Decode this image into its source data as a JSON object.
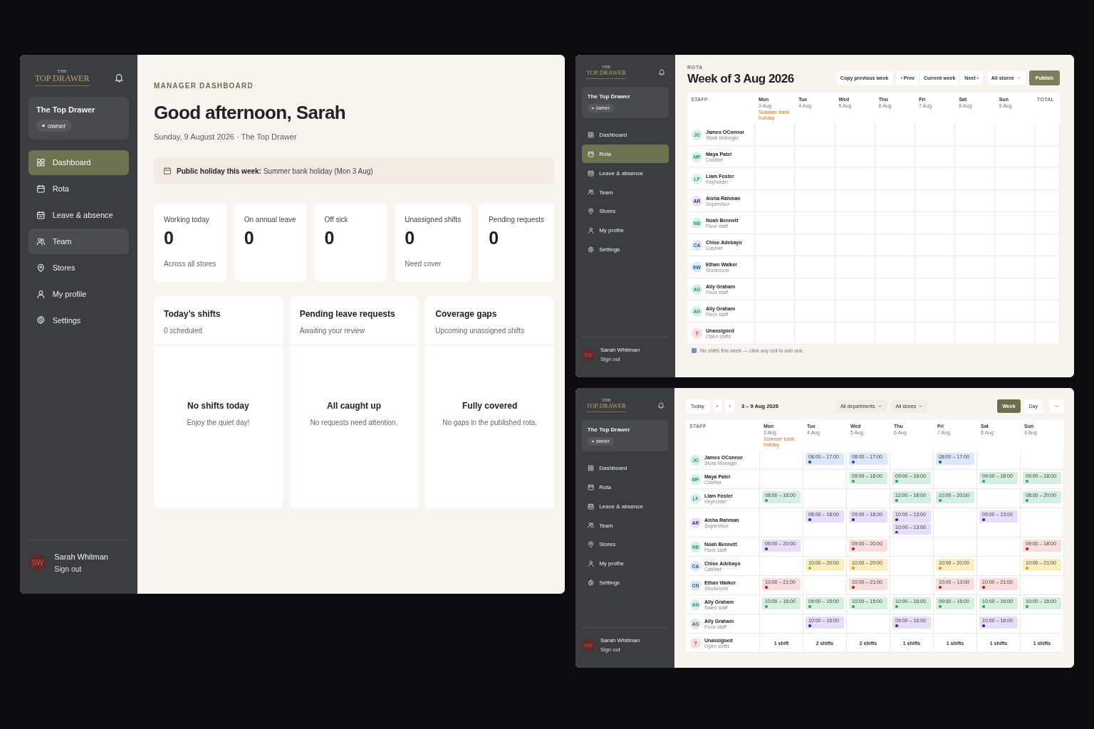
{
  "dashboard": {
    "sidebar": {
      "logo_small": "THE",
      "logo": "TOP DRAWER",
      "store": "The Top Drawer",
      "role": "owner",
      "nav": [
        {
          "label": "Dashboard",
          "selected": true,
          "hovered": false
        },
        {
          "label": "Rota",
          "selected": false,
          "hovered": false
        },
        {
          "label": "Leave & absence",
          "selected": false,
          "hovered": false
        },
        {
          "label": "Team",
          "selected": false,
          "hovered": true
        },
        {
          "label": "Stores",
          "selected": false,
          "hovered": false
        },
        {
          "label": "My profile",
          "selected": false,
          "hovered": false
        },
        {
          "label": "Settings",
          "selected": false,
          "hovered": false
        }
      ],
      "user": {
        "initials": "SW",
        "name": "Sarah Whitman",
        "sign_out": "Sign out"
      }
    },
    "eyebrow": "MANAGER DASHBOARD",
    "greeting": "Good afternoon, Sarah",
    "date_line": "Sunday, 9 August 2026 · The Top Drawer",
    "holiday_banner": "**Public holiday this week:** Summer bank holiday (Mon 3 Aug)",
    "stats": [
      {
        "label": "Working today",
        "value": "0",
        "note": "Across all stores"
      },
      {
        "label": "On annual leave",
        "value": "0"
      },
      {
        "label": "Off sick",
        "value": "0"
      },
      {
        "label": "Unassigned shifts",
        "value": "0",
        "note": "Need cover"
      },
      {
        "label": "Pending requests",
        "value": "0"
      }
    ],
    "panels": [
      {
        "title": "Today’s shifts",
        "subtitle": "0 scheduled",
        "empty_title": "No shifts today",
        "empty_text": "Enjoy the quiet day!"
      },
      {
        "title": "Pending leave requests",
        "subtitle": "Awaiting your review",
        "empty_title": "All caught up",
        "empty_text": "No requests need attention."
      },
      {
        "title": "Coverage gaps",
        "subtitle": "Upcoming unassigned shifts",
        "empty_title": "Fully covered",
        "empty_text": "No gaps in the published rota."
      }
    ]
  },
  "rota_empty": {
    "sidebar": {
      "logo_small": "THE",
      "logo": "TOP DRAWER",
      "store": "The Top Drawer",
      "role": "owner",
      "nav": [
        {
          "label": "Dashboard",
          "selected": false,
          "hovered": false
        },
        {
          "label": "Rota",
          "selected": true,
          "hovered": false
        },
        {
          "label": "Leave & absence",
          "selected": false,
          "hovered": false
        },
        {
          "label": "Team",
          "selected": false,
          "hovered": false
        },
        {
          "label": "Stores",
          "selected": false,
          "hovered": false
        },
        {
          "label": "My profile",
          "selected": false,
          "hovered": false
        },
        {
          "label": "Settings",
          "selected": false,
          "hovered": false
        }
      ],
      "user": {
        "initials": "SW",
        "name": "Sarah Whitman",
        "sign_out": "Sign out"
      }
    },
    "eyebrow": "ROTA",
    "title": "Week of 3 Aug 2026",
    "toolbar": {
      "copy": "Copy previous week",
      "nav_buttons": [
        "‹ Prev",
        "Current week",
        "Next ›"
      ],
      "store_filter": "All stores",
      "publish": "Publish"
    },
    "grid": {
      "staff_label": "STAFF",
      "total_label": "TOTAL",
      "days": [
        {
          "day": "Mon",
          "date": "3 Aug",
          "note": "Summer bank holiday"
        },
        {
          "day": "Tue",
          "date": "4 Aug"
        },
        {
          "day": "Wed",
          "date": "5 Aug"
        },
        {
          "day": "Thu",
          "date": "6 Aug"
        },
        {
          "day": "Fri",
          "date": "7 Aug"
        },
        {
          "day": "Sat",
          "date": "8 Aug"
        },
        {
          "day": "Sun",
          "date": "9 Aug"
        }
      ],
      "rows": [
        {
          "initials": "JO",
          "name": "James OConnor",
          "role": "Store Manager",
          "color": "#d6f0eb"
        },
        {
          "initials": "MP",
          "name": "Maya Patel",
          "role": "Cashier",
          "color": "#d6f0eb"
        },
        {
          "initials": "LF",
          "name": "Liam Foster",
          "role": "Keyholder",
          "color": "#d6f0eb"
        },
        {
          "initials": "AR",
          "name": "Aisha Rahman",
          "role": "Supervisor",
          "color": "#e9e1f8"
        },
        {
          "initials": "NB",
          "name": "Noah Bennett",
          "role": "Floor staff",
          "color": "#d6f0eb"
        },
        {
          "initials": "CA",
          "name": "Chloe Adebayo",
          "role": "Cashier",
          "color": "#dde8f8"
        },
        {
          "initials": "EW",
          "name": "Ethan Walker",
          "role": "Stockroom",
          "color": "#dde8f8"
        },
        {
          "initials": "AG",
          "name": "Ally Graham",
          "role": "Floor staff",
          "color": "#d6f0eb"
        },
        {
          "initials": "AG",
          "name": "Ally Graham",
          "role": "Floor staff",
          "color": "#d6f0eb"
        },
        {
          "initials": "?",
          "name": "Unassigned",
          "role": "Open shifts",
          "color": "#f9dedd"
        }
      ]
    },
    "footer_note": "No shifts this week — click any cell to add one."
  },
  "rota_filled": {
    "sidebar": {
      "logo_small": "THE",
      "logo": "TOP DRAWER",
      "store": "The Top Drawer",
      "role": "owner",
      "nav": [
        {
          "label": "Dashboard",
          "selected": false,
          "hovered": false
        },
        {
          "label": "Rota",
          "selected": false,
          "hovered": false
        },
        {
          "label": "Leave & absence",
          "selected": false,
          "hovered": false
        },
        {
          "label": "Team",
          "selected": false,
          "hovered": false
        },
        {
          "label": "Stores",
          "selected": false,
          "hovered": false
        },
        {
          "label": "My profile",
          "selected": false,
          "hovered": false
        },
        {
          "label": "Settings",
          "selected": false,
          "hovered": false
        }
      ],
      "user": {
        "initials": "SW",
        "name": "Sarah Whitman",
        "sign_out": "Sign out"
      }
    },
    "toolbar": {
      "today": "Today",
      "prev": "‹",
      "next": "›",
      "range": "3 – 9 Aug 2026",
      "filters": [
        "All departments",
        "All stores"
      ],
      "views": [
        {
          "label": "Week",
          "selected": true
        },
        {
          "label": "Day",
          "selected": false
        }
      ],
      "more": "···"
    },
    "grid": {
      "staff_label": "STAFF",
      "days": [
        {
          "day": "Mon",
          "date": "3 Aug",
          "note": "Summer bank holiday"
        },
        {
          "day": "Tue",
          "date": "4 Aug"
        },
        {
          "day": "Wed",
          "date": "5 Aug"
        },
        {
          "day": "Thu",
          "date": "6 Aug"
        },
        {
          "day": "Fri",
          "date": "7 Aug"
        },
        {
          "day": "Sat",
          "date": "8 Aug"
        },
        {
          "day": "Sun",
          "date": "9 Aug"
        }
      ],
      "rows": [
        {
          "kind": "staff",
          "initials": "JO",
          "name": "James OConnor",
          "role": "Store Manager",
          "color": "#d6f0eb",
          "cells": [
            [],
            [
              {
                "time": "08:00 – 17:00",
                "color": "#dce7fb"
              }
            ],
            [
              {
                "time": "08:00 – 17:00",
                "color": "#dce7fb"
              }
            ],
            [],
            [
              {
                "time": "08:00 – 17:00",
                "color": "#dce7fb"
              }
            ],
            [],
            []
          ]
        },
        {
          "kind": "staff",
          "initials": "MP",
          "name": "Maya Patel",
          "role": "Cashier",
          "color": "#d6f0eb",
          "cells": [
            [],
            [],
            [
              {
                "time": "09:00 – 18:00",
                "color": "#d5efe2"
              }
            ],
            [
              {
                "time": "09:00 – 18:00",
                "color": "#d5efe2"
              }
            ],
            [],
            [
              {
                "time": "09:00 – 18:00",
                "color": "#d5efe2"
              }
            ],
            [
              {
                "time": "09:00 – 18:00",
                "color": "#d5efe2"
              }
            ]
          ]
        },
        {
          "kind": "staff",
          "initials": "LF",
          "name": "Liam Foster",
          "role": "Keyholder",
          "color": "#d6f0eb",
          "cells": [
            [
              {
                "time": "08:00 – 18:00",
                "color": "#d5efe2"
              }
            ],
            [],
            [],
            [
              {
                "time": "12:00 – 18:00",
                "color": "#d5efe2"
              }
            ],
            [
              {
                "time": "10:00 – 20:00",
                "color": "#d5efe2"
              }
            ],
            [],
            [
              {
                "time": "08:00 – 20:00",
                "color": "#d5efe2"
              }
            ]
          ]
        },
        {
          "kind": "staff",
          "initials": "AR",
          "name": "Aisha Rahman",
          "role": "Supervisor",
          "color": "#e9e1f8",
          "cells": [
            [],
            [
              {
                "time": "08:00 – 18:00",
                "color": "#e6defa"
              }
            ],
            [
              {
                "time": "09:00 – 18:00",
                "color": "#e6defa"
              }
            ],
            [
              {
                "time": "10:00 – 13:00",
                "color": "#e6defa"
              },
              {
                "time": "10:00 – 13:00",
                "color": "#e6defa"
              }
            ],
            [],
            [
              {
                "time": "09:00 – 13:00",
                "color": "#e6defa"
              }
            ],
            []
          ]
        },
        {
          "kind": "staff",
          "initials": "NB",
          "name": "Noah Bennett",
          "role": "Floor staff",
          "color": "#d6f0eb",
          "cells": [
            [
              {
                "time": "09:00 – 20:00",
                "color": "#e6defa"
              }
            ],
            [],
            [
              {
                "time": "09:00 – 20:00",
                "color": "#fadede"
              }
            ],
            [],
            [],
            [],
            [
              {
                "time": "09:00 – 18:00",
                "color": "#fadede"
              }
            ]
          ]
        },
        {
          "kind": "staff",
          "initials": "CA",
          "name": "Chloe Adebayo",
          "role": "Cashier",
          "color": "#dde8f8",
          "cells": [
            [],
            [
              {
                "time": "10:00 – 20:00",
                "color": "#fbefc2"
              }
            ],
            [
              {
                "time": "10:00 – 20:00",
                "color": "#fbefc2"
              }
            ],
            [],
            [
              {
                "time": "10:00 – 20:00",
                "color": "#fbefc2"
              }
            ],
            [],
            [
              {
                "time": "10:00 – 21:00",
                "color": "#fbefc2"
              }
            ]
          ]
        },
        {
          "kind": "staff",
          "initials": "CN",
          "name": "Ethan Walker",
          "role": "Stockroom",
          "color": "#dde8f8",
          "cells": [
            [
              {
                "time": "10:00 – 21:00",
                "color": "#fadede"
              }
            ],
            [],
            [
              {
                "time": "10:00 – 21:00",
                "color": "#fadede"
              }
            ],
            [],
            [
              {
                "time": "10:00 – 13:00",
                "color": "#fadede"
              }
            ],
            [
              {
                "time": "10:00 – 21:00",
                "color": "#fadede"
              }
            ],
            []
          ]
        },
        {
          "kind": "staff",
          "initials": "AN",
          "name": "Ally Graham",
          "role": "Sales staff",
          "color": "#d6f0eb",
          "cells": [
            [
              {
                "time": "10:00 – 16:00",
                "color": "#d5efe2"
              }
            ],
            [
              {
                "time": "09:00 – 15:00",
                "color": "#d5efe2"
              }
            ],
            [
              {
                "time": "10:00 – 15:00",
                "color": "#d5efe2"
              }
            ],
            [
              {
                "time": "10:00 – 16:00",
                "color": "#d5efe2"
              }
            ],
            [
              {
                "time": "09:00 – 16:00",
                "color": "#d5efe2"
              }
            ],
            [
              {
                "time": "10:00 – 16:00",
                "color": "#d5efe2"
              }
            ],
            [
              {
                "time": "10:00 – 16:00",
                "color": "#d5efe2"
              }
            ]
          ]
        },
        {
          "kind": "staff",
          "initials": "AG",
          "name": "Ally Graham",
          "role": "Floor staff",
          "color": "#e3e8e6",
          "cells": [
            [],
            [
              {
                "time": "10:00 – 16:00",
                "color": "#e6defa"
              }
            ],
            [],
            [
              {
                "time": "09:00 – 16:00",
                "color": "#e6defa"
              }
            ],
            [],
            [
              {
                "time": "10:00 – 16:00",
                "color": "#e6defa"
              }
            ],
            []
          ]
        },
        {
          "kind": "open",
          "initials": "?",
          "name": "Unassigned",
          "role": "Open shifts",
          "color": "#f9dedd",
          "counts": [
            "1 shift",
            "2 shifts",
            "2 shifts",
            "1 shifts",
            "1 shifts",
            "1 shifts",
            "1 shifts"
          ]
        }
      ]
    }
  }
}
